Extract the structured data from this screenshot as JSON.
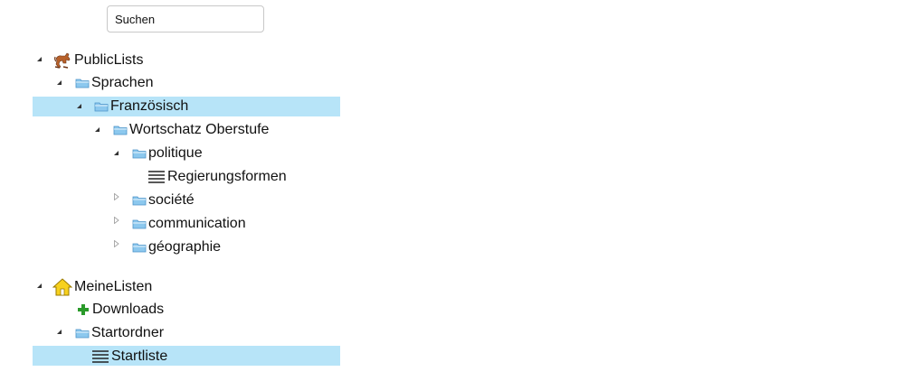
{
  "search": {
    "placeholder": "Suchen"
  },
  "tree": {
    "public": {
      "label": "PublicLists",
      "sprachen": "Sprachen",
      "franzoesisch": "Französisch",
      "wortschatz": "Wortschatz Oberstufe",
      "politique": "politique",
      "regierungsformen": "Regierungsformen",
      "societe": "société",
      "communication": "communication",
      "geographie": "géographie"
    },
    "meine": {
      "label": "MeineListen",
      "downloads": "Downloads",
      "startordner": "Startordner",
      "startliste": "Startliste"
    }
  },
  "icons": {
    "root_public": "horse-icon",
    "root_meine": "home-icon",
    "folder": "folder-icon",
    "list": "list-icon",
    "add": "plus-icon",
    "expanded": "triangle-expanded-icon",
    "collapsed": "triangle-collapsed-icon"
  },
  "colors": {
    "selection": "#b7e4f8",
    "folder": "#8cc8ee",
    "plus": "#2a9a2a",
    "home": "#f7d11e"
  }
}
